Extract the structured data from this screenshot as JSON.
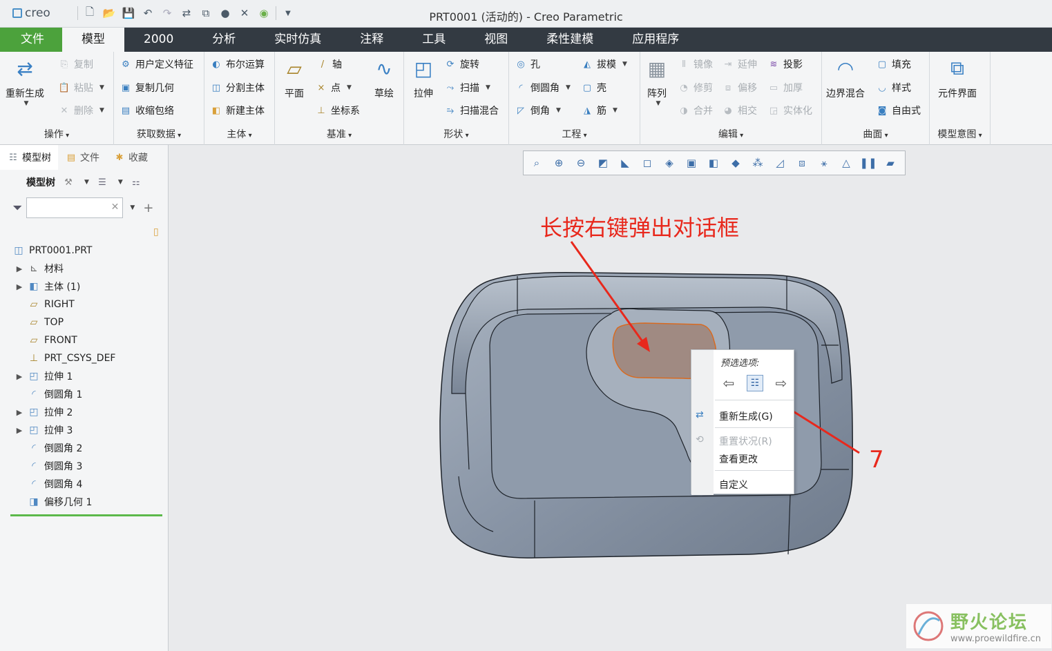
{
  "titlebar": {
    "logo": "creo",
    "window_title": "PRT0001 (活动的) - Creo Parametric"
  },
  "menu": {
    "tabs": [
      "文件",
      "模型",
      "2000",
      "分析",
      "实时仿真",
      "注释",
      "工具",
      "视图",
      "柔性建模",
      "应用程序"
    ],
    "active_tab": "模型"
  },
  "ribbon": {
    "operations": {
      "label": "操作",
      "regenerate": "重新生成",
      "copy": "复制",
      "paste": "粘贴",
      "delete": "删除"
    },
    "get_data": {
      "label": "获取数据",
      "udf": "用户定义特征",
      "copy_geom": "复制几何",
      "shrinkwrap": "收缩包络"
    },
    "body": {
      "label": "主体",
      "boolean": "布尔运算",
      "split": "分割主体",
      "new_body": "新建主体"
    },
    "datum": {
      "label": "基准",
      "plane": "平面",
      "axis": "轴",
      "point": "点",
      "csys": "坐标系",
      "sketch": "草绘"
    },
    "shapes": {
      "label": "形状",
      "extrude": "拉伸",
      "revolve": "旋转",
      "sweep": "扫描",
      "swept_blend": "扫描混合"
    },
    "engineering": {
      "label": "工程",
      "hole": "孔",
      "round": "倒圆角",
      "chamfer": "倒角",
      "draft": "拔模",
      "shell": "壳",
      "rib": "筋"
    },
    "editing": {
      "label": "编辑",
      "pattern": "阵列",
      "mirror": "镜像",
      "extend": "延伸",
      "project": "投影",
      "trim": "修剪",
      "offset": "偏移",
      "thicken": "加厚",
      "merge": "合并",
      "intersect": "相交",
      "solidify": "实体化"
    },
    "surfaces": {
      "label": "曲面",
      "boundary_blend": "边界混合",
      "fill": "填充",
      "style": "样式",
      "freestyle": "自由式"
    },
    "model_intent": {
      "label": "模型意图",
      "component_interface": "元件界面"
    }
  },
  "left_panel": {
    "tabs": [
      "模型树",
      "文件",
      "收藏"
    ],
    "tree_toolbar_label": "模型树",
    "search_placeholder": "",
    "tree": [
      {
        "label": "PRT0001.PRT",
        "icon": "part-icon",
        "expand": false
      },
      {
        "label": "材料",
        "icon": "material-icon",
        "expand": true
      },
      {
        "label": "主体 (1)",
        "icon": "body-icon",
        "expand": true
      },
      {
        "label": "RIGHT",
        "icon": "datum-plane-icon",
        "expand": false
      },
      {
        "label": "TOP",
        "icon": "datum-plane-icon",
        "expand": false
      },
      {
        "label": "FRONT",
        "icon": "datum-plane-icon",
        "expand": false
      },
      {
        "label": "PRT_CSYS_DEF",
        "icon": "csys-icon",
        "expand": false
      },
      {
        "label": "拉伸 1",
        "icon": "extrude-icon",
        "expand": true
      },
      {
        "label": "倒圆角 1",
        "icon": "round-icon",
        "expand": false
      },
      {
        "label": "拉伸 2",
        "icon": "extrude-icon",
        "expand": true
      },
      {
        "label": "拉伸 3",
        "icon": "extrude-icon",
        "expand": true
      },
      {
        "label": "倒圆角 2",
        "icon": "round-icon",
        "expand": false
      },
      {
        "label": "倒圆角 3",
        "icon": "round-icon",
        "expand": false
      },
      {
        "label": "倒圆角 4",
        "icon": "round-icon",
        "expand": false
      },
      {
        "label": "偏移几何 1",
        "icon": "offset-geom-icon",
        "expand": false
      }
    ]
  },
  "graphics": {
    "annotation": "长按右键弹出对话框",
    "callout_number": "7"
  },
  "context_menu": {
    "header": "预选选项:",
    "regenerate": "重新生成(G)",
    "reset_status": "重置状况(R)",
    "view_changes": "查看更改",
    "customize": "自定义"
  },
  "watermark": {
    "name": "野火论坛",
    "url": "www.proewildfire.cn"
  },
  "colors": {
    "file_tab": "#4ca23c",
    "menubar": "#333a42",
    "annotation": "#e8281c",
    "model_body": "#8e9aaa",
    "highlight_face": "#a08a82"
  }
}
